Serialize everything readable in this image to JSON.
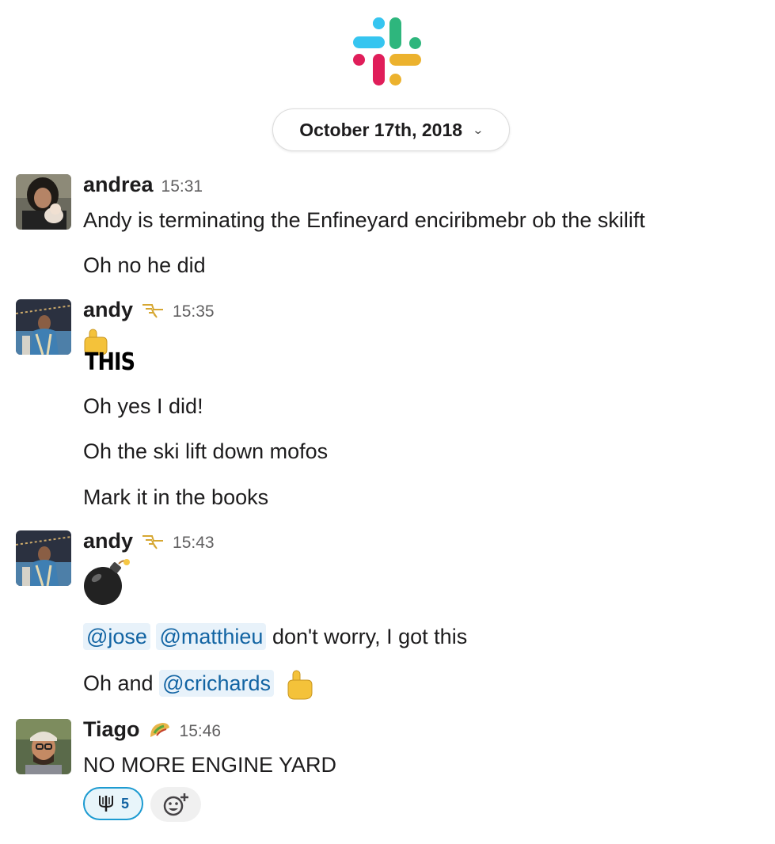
{
  "date_divider": {
    "label": "October 17th, 2018"
  },
  "colors": {
    "mention_bg": "#e8f2fa",
    "mention_text": "#1264a3",
    "reaction_border": "#1d9bd1",
    "logo_blue": "#36c5f0",
    "logo_green": "#2eb67d",
    "logo_yellow": "#ecb22e",
    "logo_red": "#e01e5a"
  },
  "messages": [
    {
      "sender": "andrea",
      "time": "15:31",
      "lines": [
        "Andy is terminating the Enfineyard enciribmebr ob the skilift",
        "Oh no he did"
      ]
    },
    {
      "sender": "andy",
      "status_icon": "airline-wings-icon",
      "time": "15:35",
      "custom_emoji_text": "THIS",
      "lines": [
        "Oh yes I did!",
        "Oh the ski lift down mofos",
        "Mark it in the books"
      ]
    },
    {
      "sender": "andy",
      "status_icon": "airline-wings-icon",
      "time": "15:43",
      "emoji": "bomb-icon",
      "line1_mentions": [
        "@jose",
        "@matthieu"
      ],
      "line1_text": " don't worry, I got this",
      "line2_prefix": "Oh and ",
      "line2_mention": "@crichards",
      "line2_emoji": "pointing-up-icon"
    },
    {
      "sender": "Tiago",
      "status_icon": "taco-icon",
      "time": "15:46",
      "lines": [
        "NO MORE ENGINE YARD"
      ],
      "reaction": {
        "emoji": "trident-icon",
        "count": "5"
      },
      "add_reaction_icon": "add-reaction-icon"
    }
  ]
}
